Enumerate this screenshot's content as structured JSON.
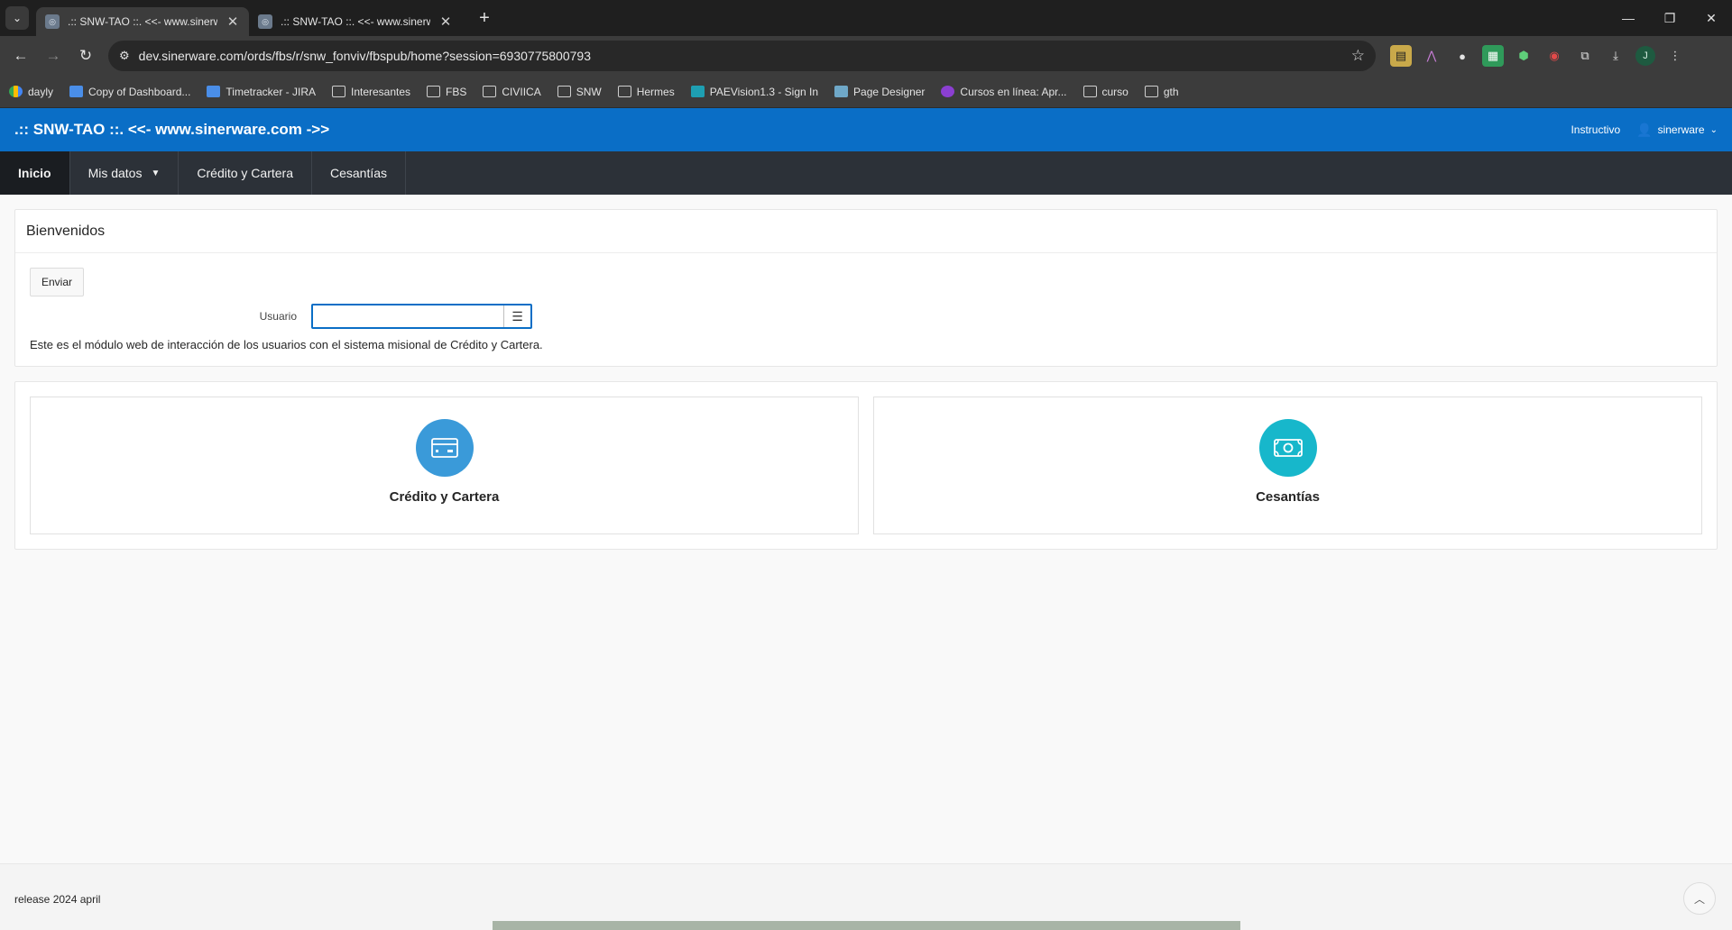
{
  "browser": {
    "tabs": [
      {
        "title": ".:: SNW-TAO ::. <<- www.sinerw",
        "active": true
      },
      {
        "title": ".:: SNW-TAO ::. <<- www.sinerw",
        "active": false
      }
    ],
    "url": "dev.sinerware.com/ords/fbs/r/snw_fonviv/fbspub/home?session=6930775800793",
    "profile_initial": "J",
    "bookmarks": [
      {
        "label": "dayly",
        "icon": "multi"
      },
      {
        "label": "Copy of Dashboard...",
        "icon": "blue"
      },
      {
        "label": "Timetracker - JIRA",
        "icon": "blue"
      },
      {
        "label": "Interesantes",
        "icon": "folder"
      },
      {
        "label": "FBS",
        "icon": "folder"
      },
      {
        "label": "CIVIICA",
        "icon": "folder"
      },
      {
        "label": "SNW",
        "icon": "folder"
      },
      {
        "label": "Hermes",
        "icon": "folder"
      },
      {
        "label": "PAEVision1.3 - Sign In",
        "icon": "teal"
      },
      {
        "label": "Page Designer",
        "icon": "designer"
      },
      {
        "label": "Cursos en línea: Apr...",
        "icon": "purple"
      },
      {
        "label": "curso",
        "icon": "folder"
      },
      {
        "label": "gth",
        "icon": "folder"
      }
    ]
  },
  "app": {
    "title": ".:: SNW-TAO ::. <<- www.sinerware.com ->>",
    "instructivo": "Instructivo",
    "username": "sinerware"
  },
  "menu": {
    "items": [
      "Inicio",
      "Mis datos",
      "Crédito y Cartera",
      "Cesantías"
    ]
  },
  "welcome": {
    "heading": "Bienvenidos",
    "send_button": "Enviar",
    "user_label": "Usuario",
    "user_value": "",
    "description": "Este es el módulo web de interacción de los usuarios con el sistema misional de Crédito y Cartera."
  },
  "cards": [
    {
      "title": "Crédito y Cartera",
      "icon": "credit-card-icon",
      "color": "#3a9ad9"
    },
    {
      "title": "Cesantías",
      "icon": "money-bill-icon",
      "color": "#17b7cb"
    }
  ],
  "footer": {
    "release": "release 2024 april"
  },
  "colors": {
    "header_blue": "#0a6ec6",
    "menubar": "#2c3138"
  }
}
